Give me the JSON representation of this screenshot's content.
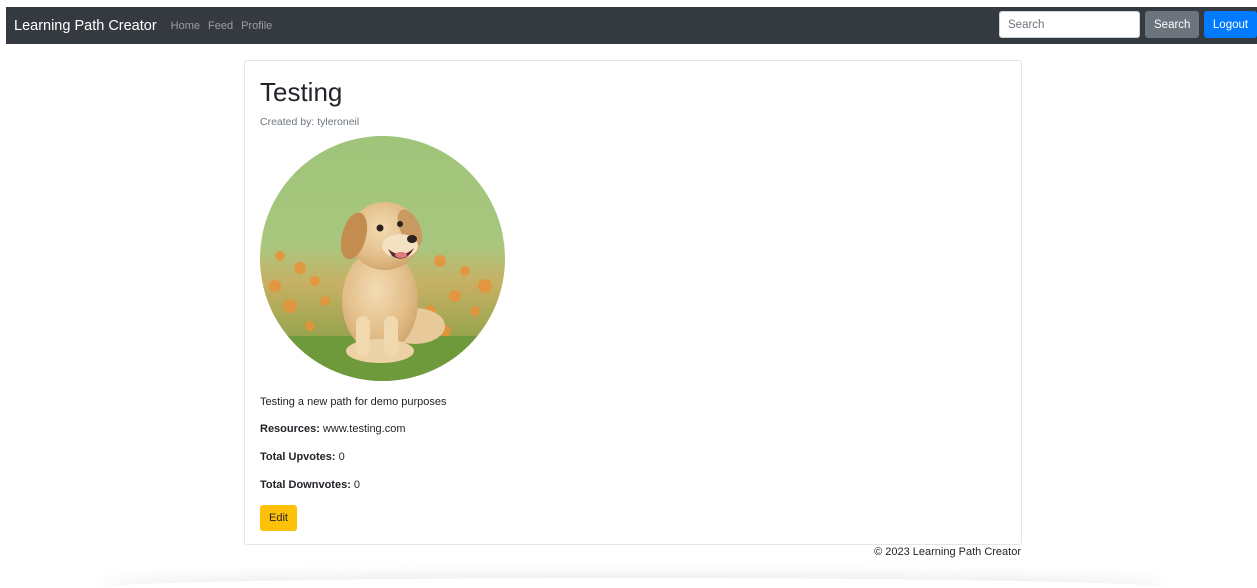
{
  "navbar": {
    "brand": "Learning Path Creator",
    "links": [
      "Home",
      "Feed",
      "Profile"
    ],
    "search_placeholder": "Search",
    "search_button": "Search",
    "logout_button": "Logout"
  },
  "path": {
    "title": "Testing",
    "created_by": "Created by: tyleroneil",
    "image_icon": "puppy-photo",
    "description": "Testing a new path for demo purposes",
    "resources_label": "Resources:",
    "resources_value": "www.testing.com",
    "upvotes_label": "Total Upvotes:",
    "upvotes_value": "0",
    "downvotes_label": "Total Downvotes:",
    "downvotes_value": "0",
    "edit_button": "Edit"
  },
  "footer": {
    "text": "© 2023 Learning Path Creator"
  },
  "colors": {
    "navbar_bg": "#343a40",
    "search_btn": "#6c757d",
    "logout_btn": "#007bff",
    "edit_btn": "#ffc107"
  }
}
